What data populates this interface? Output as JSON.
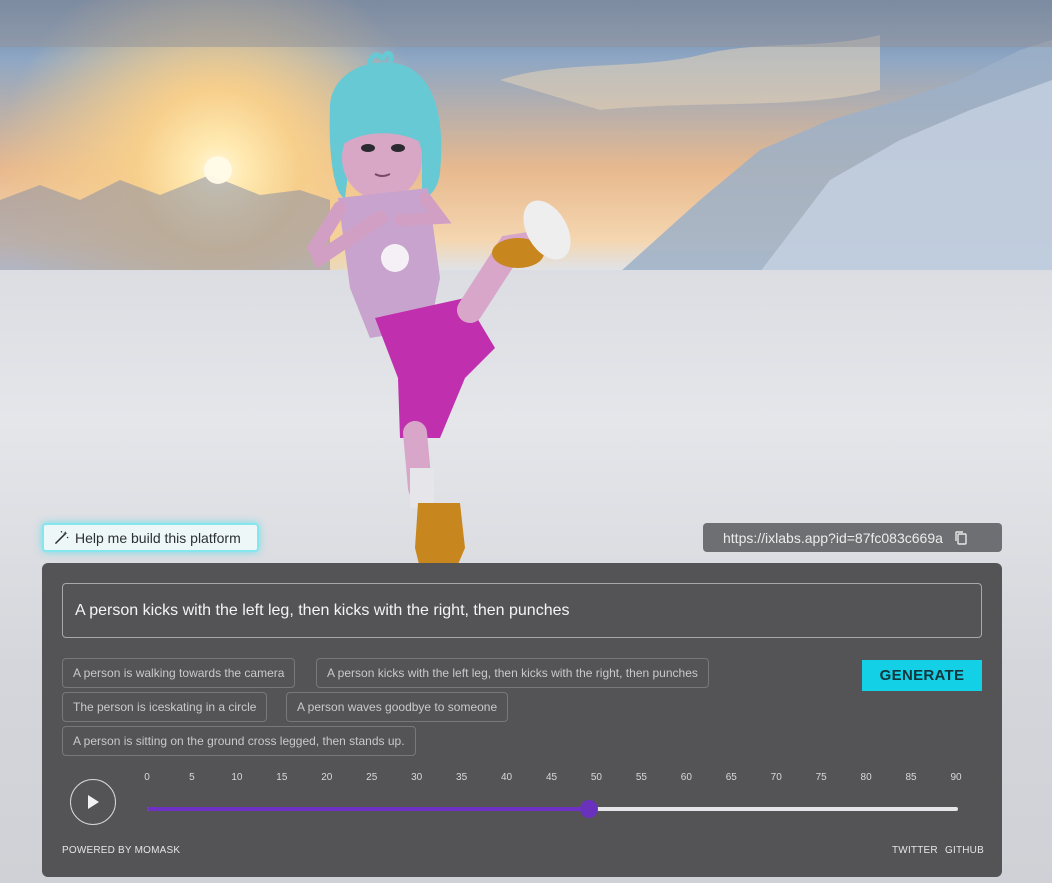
{
  "help_button": {
    "label": "Help me build this platform",
    "icon": "magic-wand-icon"
  },
  "share": {
    "url": "https://ixlabs.app?id=87fc083c669a",
    "icon": "copy-icon"
  },
  "prompt": {
    "value": "A person kicks with the left leg, then kicks with the right, then punches"
  },
  "suggestions": [
    "A person is walking towards the camera",
    "A person kicks with the left leg, then kicks with the right, then punches",
    "The person is iceskating in a circle",
    "A person waves goodbye to someone",
    "A person is sitting on the ground cross legged, then stands up."
  ],
  "generate_label": "GENERATE",
  "timeline": {
    "ticks": [
      "0",
      "5",
      "10",
      "15",
      "20",
      "25",
      "30",
      "35",
      "40",
      "45",
      "50",
      "55",
      "60",
      "65",
      "70",
      "75",
      "80",
      "85",
      "90"
    ],
    "position": 49,
    "max": 90,
    "play_icon": "play-icon"
  },
  "footer": {
    "powered_by": "POWERED BY MOMASK",
    "twitter": "TWITTER",
    "github": "GITHUB"
  },
  "colors": {
    "accent_cyan": "#14d0e6",
    "slider_purple": "#6f31c4",
    "panel_bg": "#545456"
  }
}
